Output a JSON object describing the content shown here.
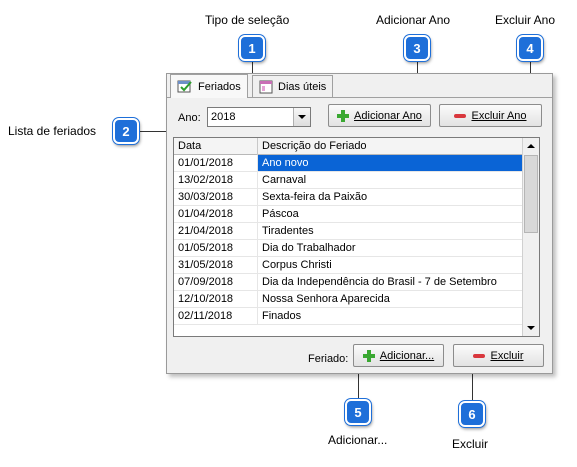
{
  "callouts": {
    "c1": {
      "number": "1",
      "label": "Tipo de seleção"
    },
    "c2": {
      "number": "2",
      "label": "Lista de feriados"
    },
    "c3": {
      "number": "3",
      "label": "Adicionar Ano"
    },
    "c4": {
      "number": "4",
      "label": "Excluir Ano"
    },
    "c5": {
      "number": "5",
      "label": "Adicionar..."
    },
    "c6": {
      "number": "6",
      "label": "Excluir"
    }
  },
  "tabs": [
    {
      "label": "Feriados",
      "icon": "calendar-check-icon",
      "active": true
    },
    {
      "label": "Dias úteis",
      "icon": "calendar-grid-icon",
      "active": false
    }
  ],
  "year": {
    "label": "Ano:",
    "value": "2018"
  },
  "buttons": {
    "add_year": "Adicionar Ano",
    "delete_year": "Excluir Ano",
    "add": "Adicionar...",
    "delete": "Excluir"
  },
  "feriado_label": "Feriado:",
  "table": {
    "columns": [
      "Data",
      "Descrição do Feriado"
    ],
    "rows": [
      [
        "01/01/2018",
        "Ano novo"
      ],
      [
        "13/02/2018",
        "Carnaval"
      ],
      [
        "30/03/2018",
        "Sexta-feira da Paixão"
      ],
      [
        "01/04/2018",
        "Páscoa"
      ],
      [
        "21/04/2018",
        "Tiradentes"
      ],
      [
        "01/05/2018",
        "Dia do Trabalhador"
      ],
      [
        "31/05/2018",
        "Corpus Christi"
      ],
      [
        "07/09/2018",
        "Dia da Independência do Brasil - 7 de Setembro"
      ],
      [
        "12/10/2018",
        "Nossa Senhora Aparecida"
      ],
      [
        "02/11/2018",
        "Finados"
      ]
    ],
    "selected_row": 0
  },
  "colors": {
    "callout_badge": "#1e6fd9",
    "selection": "#0a64d6",
    "add_icon": "#3aa832",
    "remove_icon": "#d9373d"
  }
}
